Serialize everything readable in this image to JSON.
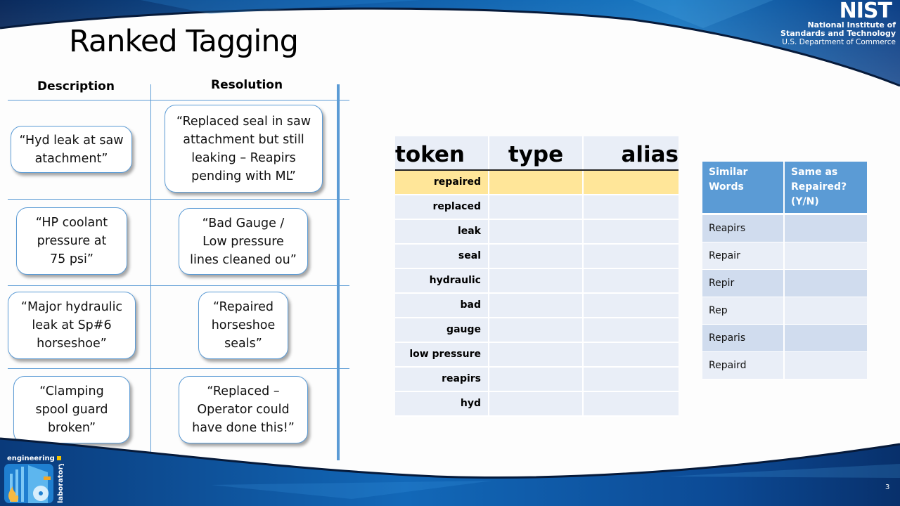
{
  "slide": {
    "title": "Ranked Tagging",
    "page_number": "3"
  },
  "branding": {
    "nist_mark": "NIST",
    "nist_line1": "National Institute of",
    "nist_line2": "Standards and Technology",
    "nist_line3": "U.S. Department of Commerce",
    "lab_word1": "engineering",
    "lab_word2": "laboratory"
  },
  "work_orders": {
    "headers": {
      "description": "Description",
      "resolution": "Resolution"
    },
    "rows": [
      {
        "description": "“Hyd leak at saw\natachment”",
        "resolution": "“Replaced seal in saw\nattachment but still\nleaking – Reapirs\npending with ML”"
      },
      {
        "description": "“HP coolant\npressure at\n75 psi”",
        "resolution": "“Bad Gauge /\nLow pressure\nlines cleaned ou”"
      },
      {
        "description": "“Major hydraulic\nleak at Sp#6\nhorseshoe”",
        "resolution": "“Repaired\nhorseshoe\nseals”"
      },
      {
        "description": "“Clamping\nspool guard\nbroken”",
        "resolution": "“Replaced –\nOperator could\nhave done this!”"
      }
    ]
  },
  "token_table": {
    "headers": {
      "token": "token",
      "type": "type",
      "alias": "alias"
    },
    "highlight_color": "#ffe699",
    "rows": [
      {
        "token": "repaired",
        "type": "",
        "alias": "",
        "highlighted": true
      },
      {
        "token": "replaced",
        "type": "",
        "alias": ""
      },
      {
        "token": "leak",
        "type": "",
        "alias": ""
      },
      {
        "token": "seal",
        "type": "",
        "alias": ""
      },
      {
        "token": "hydraulic",
        "type": "",
        "alias": ""
      },
      {
        "token": "bad",
        "type": "",
        "alias": ""
      },
      {
        "token": "gauge",
        "type": "",
        "alias": ""
      },
      {
        "token": "low pressure",
        "type": "",
        "alias": ""
      },
      {
        "token": "reapirs",
        "type": "",
        "alias": ""
      },
      {
        "token": "hyd",
        "type": "",
        "alias": ""
      }
    ]
  },
  "similar_table": {
    "headers": {
      "similar": "Similar\nWords",
      "same": "Same as\nRepaired?\n(Y/N)"
    },
    "header_color": "#5b9bd5",
    "rows": [
      {
        "word": "Reapirs",
        "same": ""
      },
      {
        "word": "Repair",
        "same": ""
      },
      {
        "word": "Repir",
        "same": ""
      },
      {
        "word": "Rep",
        "same": ""
      },
      {
        "word": "Reparis",
        "same": ""
      },
      {
        "word": "Repaird",
        "same": ""
      }
    ]
  }
}
